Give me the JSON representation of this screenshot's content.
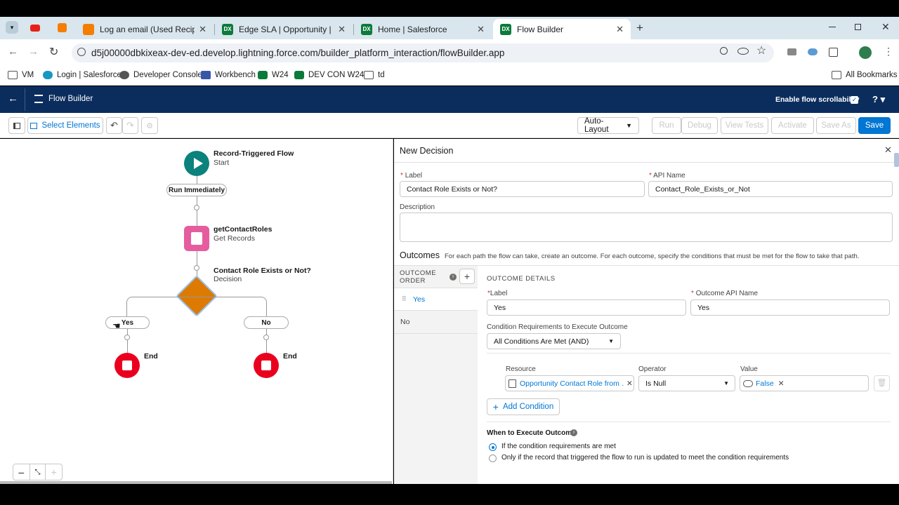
{
  "browser": {
    "tabs": [
      {
        "title": "Log an email (Used Recipient ID…",
        "icon": "blogger-icon",
        "color": "#f57d00"
      },
      {
        "title": "Edge SLA | Opportunity | Salesf…",
        "icon": "devhub-icon",
        "color": "#0c7a3a"
      },
      {
        "title": "Home | Salesforce",
        "icon": "devhub-icon",
        "color": "#0c7a3a"
      },
      {
        "title": "Flow Builder",
        "icon": "devhub-icon",
        "color": "#0c7a3a"
      }
    ],
    "url": "d5j00000dbkixeax-dev-ed.develop.lightning.force.com/builder_platform_interaction/flowBuilder.app",
    "bookmarks": [
      "VM",
      "Login | Salesforce",
      "Developer Console",
      "Workbench",
      "W24",
      "DEV CON W24",
      "td"
    ],
    "all_bookmarks": "All Bookmarks"
  },
  "header": {
    "title": "Flow Builder",
    "scroll_label": "Enable flow scrollability",
    "help": "?"
  },
  "toolbar": {
    "select_elements": "Select Elements",
    "layout": "Auto-Layout",
    "run": "Run",
    "debug": "Debug",
    "view_tests": "View Tests",
    "activate": "Activate",
    "save_as": "Save As",
    "save": "Save"
  },
  "canvas": {
    "start_title": "Record-Triggered Flow",
    "start_sub": "Start",
    "run_pill": "Run Immediately",
    "get_title": "getContactRoles",
    "get_sub": "Get Records",
    "dec_title": "Contact Role Exists or Not?",
    "dec_sub": "Decision",
    "yes": "Yes",
    "no": "No",
    "end": "End"
  },
  "panel": {
    "title": "New Decision",
    "label_lbl": "Label",
    "label_val": "Contact Role Exists or Not?",
    "api_lbl": "API Name",
    "api_val": "Contact_Role_Exists_or_Not",
    "desc_lbl": "Description",
    "outcomes": "Outcomes",
    "outcomes_help": "For each path the flow can take, create an outcome. For each outcome, specify the conditions that must be met for the flow to take that path.",
    "order_lbl": "OUTCOME ORDER",
    "order_items": [
      "Yes",
      "No"
    ],
    "details": "OUTCOME DETAILS",
    "o_label_lbl": "Label",
    "o_label_val": "Yes",
    "o_api_lbl": "Outcome API Name",
    "o_api_val": "Yes",
    "cond_req_lbl": "Condition Requirements to Execute Outcome",
    "cond_req_val": "All Conditions Are Met (AND)",
    "resource_lbl": "Resource",
    "resource_val": "Opportunity Contact Role from …",
    "operator_lbl": "Operator",
    "operator_val": "Is Null",
    "value_lbl": "Value",
    "value_val": "False",
    "add_condition": "Add Condition",
    "when_lbl": "When to Execute Outcome",
    "radio1": "If the condition requirements are met",
    "radio2": "Only if the record that triggered the flow to run is updated to meet the condition requirements"
  }
}
